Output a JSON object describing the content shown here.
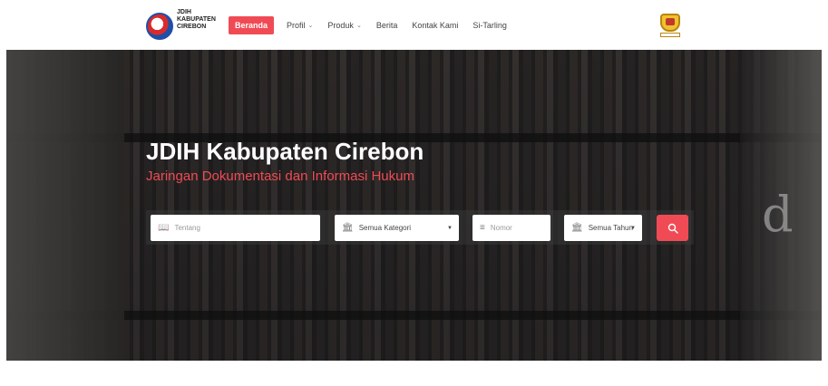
{
  "brand": {
    "line1": "JDIH",
    "line2": "KABUPATEN",
    "line3": "CIREBON"
  },
  "nav": {
    "items": [
      {
        "label": "Beranda",
        "active": true,
        "dropdown": false
      },
      {
        "label": "Profil",
        "active": false,
        "dropdown": true
      },
      {
        "label": "Produk",
        "active": false,
        "dropdown": true
      },
      {
        "label": "Berita",
        "active": false,
        "dropdown": false
      },
      {
        "label": "Kontak Kami",
        "active": false,
        "dropdown": false
      },
      {
        "label": "Si-Tarling",
        "active": false,
        "dropdown": false
      }
    ]
  },
  "hero": {
    "title": "JDIH Kabupaten Cirebon",
    "subtitle": "Jaringan Dokumentasi dan Informasi Hukum",
    "deco_letter": "d"
  },
  "search": {
    "tentang_placeholder": "Tentang",
    "kategori_value": "Semua Kategori",
    "nomor_placeholder": "Nomor",
    "tahun_value": "Semua Tahun"
  },
  "colors": {
    "accent": "#f04b55",
    "header_bg": "#ffffff"
  }
}
